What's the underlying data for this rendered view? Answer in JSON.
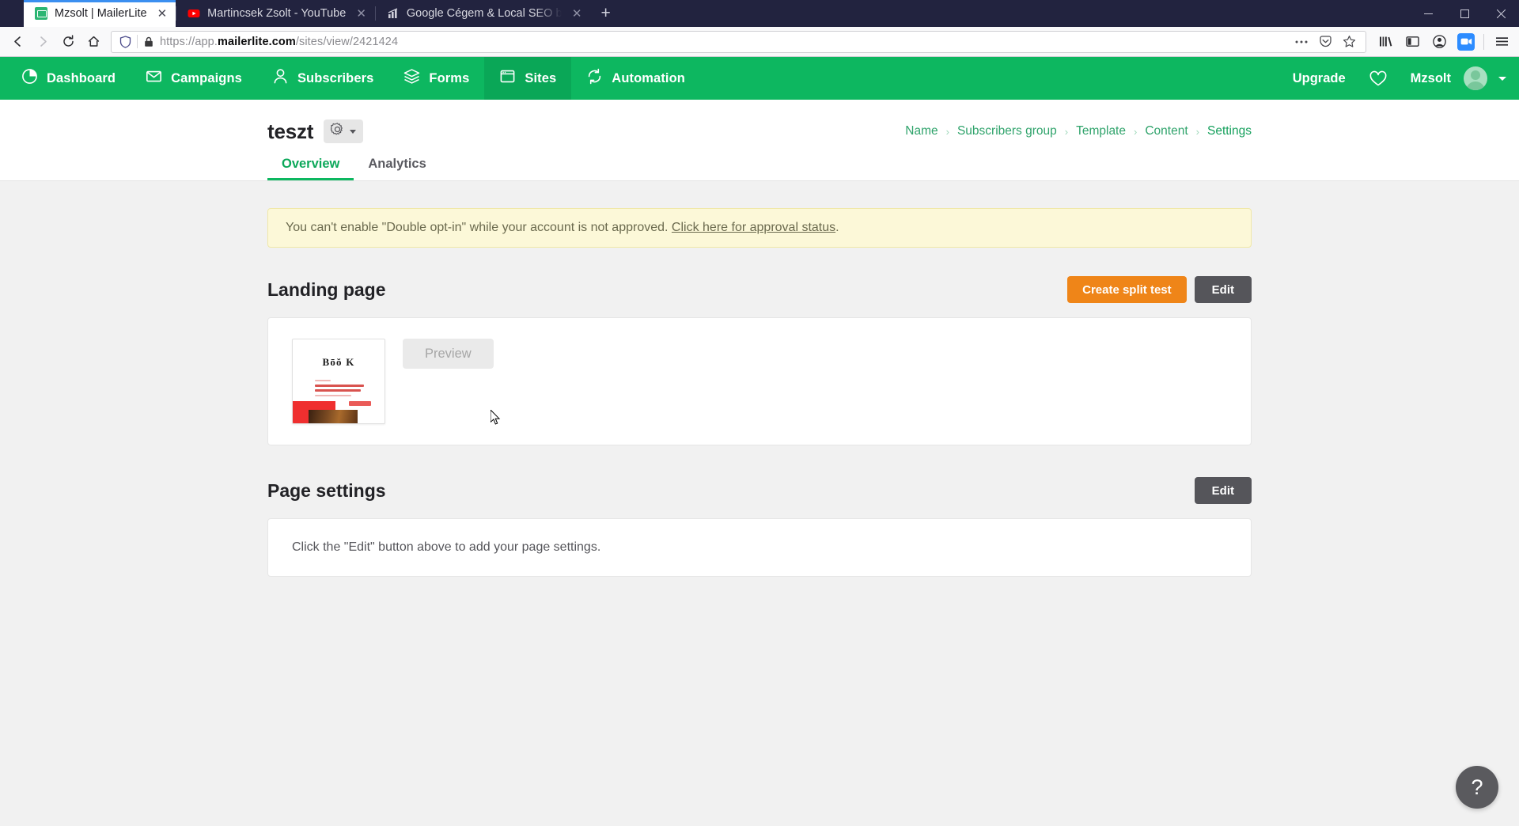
{
  "browser": {
    "tabs": [
      {
        "title": "Mzsolt | MailerLite",
        "favicon": "mailerlite-icon",
        "active": true,
        "close_label": "✕"
      },
      {
        "title": "Martincsek Zsolt - YouTube",
        "favicon": "youtube-icon",
        "active": false,
        "close_label": "✕"
      },
      {
        "title": "Google Cégem & Local SEO be",
        "favicon": "chart-icon",
        "active": false,
        "close_label": "✕"
      }
    ],
    "new_tab_label": "+",
    "window_controls": {
      "minimize": "–",
      "maximize": "☐",
      "close": "✕"
    },
    "nav": {
      "back_icon": "back-arrow-icon",
      "forward_icon": "forward-arrow-icon",
      "reload_icon": "reload-icon",
      "home_icon": "home-icon"
    },
    "url": {
      "prefix": "https://app.",
      "domain": "mailerlite.com",
      "path": "/sites/view/2421424",
      "full": "https://app.mailerlite.com/sites/view/2421424",
      "shield_icon": "tracking-shield-icon",
      "lock_icon": "padlock-icon",
      "page_actions_icon": "ellipsis-icon",
      "pocket_icon": "pocket-icon",
      "bookmark_icon": "star-icon"
    },
    "toolbar_right": {
      "library_icon": "library-icon",
      "sidebar_icon": "sidebar-icon",
      "account_icon": "account-icon",
      "zoom_icon": "zoom-video-icon",
      "menu_icon": "hamburger-menu-icon"
    }
  },
  "topnav": {
    "items": [
      {
        "label": "Dashboard",
        "icon": "dashboard-pie-icon",
        "active": false
      },
      {
        "label": "Campaigns",
        "icon": "envelope-icon",
        "active": false
      },
      {
        "label": "Subscribers",
        "icon": "person-icon",
        "active": false
      },
      {
        "label": "Forms",
        "icon": "layers-icon",
        "active": false
      },
      {
        "label": "Sites",
        "icon": "browser-window-icon",
        "active": true
      },
      {
        "label": "Automation",
        "icon": "refresh-cycle-icon",
        "active": false
      }
    ],
    "upgrade_label": "Upgrade",
    "heart_icon": "heart-icon",
    "user_name": "Mzsolt",
    "avatar_icon": "user-avatar",
    "dropdown_icon": "chevron-down-icon"
  },
  "header": {
    "page_title": "teszt",
    "gear_icon": "gear-icon",
    "gear_caret_icon": "caret-down-icon",
    "breadcrumb": [
      {
        "label": "Name",
        "current": false
      },
      {
        "label": "Subscribers group",
        "current": false
      },
      {
        "label": "Template",
        "current": false
      },
      {
        "label": "Content",
        "current": false
      },
      {
        "label": "Settings",
        "current": true
      }
    ],
    "breadcrumb_separator": "›"
  },
  "tabs": [
    {
      "label": "Overview",
      "active": true
    },
    {
      "label": "Analytics",
      "active": false
    }
  ],
  "alert": {
    "text_before": "You can't enable \"Double opt-in\" while your account is not approved. ",
    "link_text": "Click here for approval status",
    "text_after": "."
  },
  "landing_page": {
    "title": "Landing page",
    "create_split_test_label": "Create split test",
    "edit_label": "Edit",
    "preview_label": "Preview",
    "thumbnail": {
      "heading": "Bōŏ K",
      "alt": "landing-page-thumbnail"
    }
  },
  "page_settings": {
    "title": "Page settings",
    "edit_label": "Edit",
    "empty_message": "Click the \"Edit\" button above to add your page settings."
  },
  "help": {
    "label": "?"
  },
  "colors": {
    "brand_green": "#0db760",
    "active_green": "#0aa757",
    "orange": "#ef8518",
    "gray_button": "#55555a",
    "alert_bg": "#fcf8d8",
    "page_bg": "#f1f1f1"
  }
}
